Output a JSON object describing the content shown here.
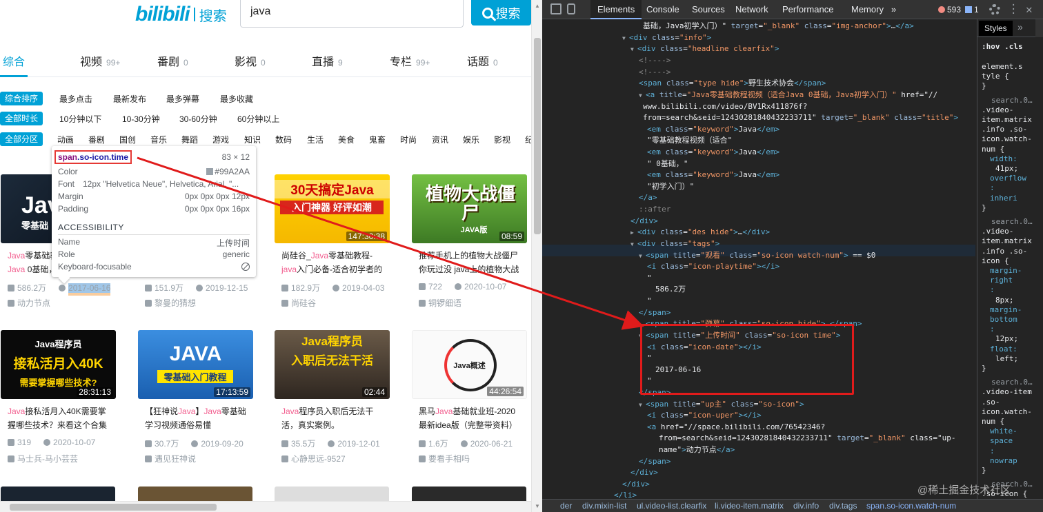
{
  "header": {
    "logo_text": "bilibili",
    "logo_sub": "搜索",
    "search_value": "java",
    "search_button": "搜索"
  },
  "tabs": [
    {
      "label": "综合",
      "count": ""
    },
    {
      "label": "视频",
      "count": "99+"
    },
    {
      "label": "番剧",
      "count": "0"
    },
    {
      "label": "影视",
      "count": "0"
    },
    {
      "label": "直播",
      "count": "9"
    },
    {
      "label": "专栏",
      "count": "99+"
    },
    {
      "label": "话题",
      "count": "0"
    }
  ],
  "filters": {
    "sort": {
      "label": "综合排序",
      "options": [
        "最多点击",
        "最新发布",
        "最多弹幕",
        "最多收藏"
      ]
    },
    "duration": {
      "label": "全部时长",
      "options": [
        "10分钟以下",
        "10-30分钟",
        "30-60分钟",
        "60分钟以上"
      ]
    },
    "zone": {
      "label": "全部分区",
      "options": [
        "动画",
        "番剧",
        "国创",
        "音乐",
        "舞蹈",
        "游戏",
        "知识",
        "数码",
        "生活",
        "美食",
        "鬼畜",
        "时尚",
        "资讯",
        "娱乐",
        "影视",
        "纪"
      ]
    }
  },
  "cards": [
    {
      "thumb_text": "Java",
      "thumb_sub": "零基础",
      "duration": "",
      "title_pre": "",
      "kw": "Java",
      "title_post": "零基础教程视频（适合",
      "line2_kw": "Java",
      "line2": " 0基础，",
      "views": "586.2万",
      "date": "2017-06-16",
      "uploader": "动力节点"
    },
    {
      "thumb_text": "",
      "thumb_sub": "",
      "duration": "",
      "title_pre": "",
      "kw": "",
      "title_post": "",
      "line2_kw": "",
      "line2": "",
      "views": "151.9万",
      "date": "2019-12-15",
      "uploader": "黎曼的猜想"
    },
    {
      "thumb_text": "30天搞定Java",
      "thumb_sub": "入门神器  好评如潮",
      "duration": "147:30:38",
      "title_pre": "尚硅谷_",
      "kw": "Java",
      "title_post": "零基础教程-",
      "line2_kw": "java",
      "line2": "入门必备-适合初学者的",
      "views": "182.9万",
      "date": "2019-04-03",
      "uploader": "尚硅谷"
    },
    {
      "thumb_text": "植物大战僵尸",
      "thumb_sub": "JAVA版",
      "duration": "08:59",
      "title_pre": "",
      "kw": "",
      "title_post": "推荐手机上的植物大战僵尸",
      "line2_kw": "",
      "line2": "你玩过没 java上的植物大战",
      "views": "722",
      "date": "2020-10-07",
      "uploader": "铜锣细语"
    },
    {
      "thumb_text": "Java程序员",
      "thumb_sub": "接私活月入40K",
      "thumb_sub2": "需要掌握哪些技术?",
      "duration": "28:31:13",
      "title_pre": "",
      "kw": "Java",
      "title_post": "接私活月入40K需要掌",
      "line2_kw": "",
      "line2": "握哪些技术？来看这个合集",
      "views": "319",
      "date": "2020-10-07",
      "uploader": "马士兵-马小芸芸"
    },
    {
      "thumb_text": "JAVA",
      "thumb_sub": "零基础入门教程",
      "duration": "17:13:59",
      "title_pre": "【狂神说",
      "kw": "Java",
      "title_post": "】",
      "title_post_kw": "Java",
      "title_post2": "零基础",
      "line2_kw": "",
      "line2": "学习视频通俗易懂",
      "views": "30.7万",
      "date": "2019-09-20",
      "uploader": "遇见狂神说"
    },
    {
      "thumb_text": "Java程序员",
      "thumb_sub": "入职后无法干活",
      "duration": "02:44",
      "title_pre": "",
      "kw": "Java",
      "title_post": "程序员入职后无法干",
      "line2_kw": "",
      "line2": "活，真实案例。",
      "views": "35.5万",
      "date": "2019-12-01",
      "uploader": "心静思远-9527"
    },
    {
      "thumb_text": "Java概述",
      "thumb_sub": "",
      "duration": "44:26:54",
      "title_pre": "黑马",
      "kw": "Java",
      "title_post": "基础就业班-2020",
      "line2_kw": "",
      "line2": "最新idea版（完整带资料）",
      "views": "1.6万",
      "date": "2020-06-21",
      "uploader": "要看手相吗"
    }
  ],
  "tooltip": {
    "selector_tag": "span",
    "selector_class": ".so-icon.time",
    "size": "83 × 12",
    "rows": [
      {
        "k": "Color",
        "v": "#99A2AA"
      },
      {
        "k": "Font",
        "v": "12px \"Helvetica Neue\", Helvetica, Arial, \"..."
      },
      {
        "k": "Margin",
        "v": "0px 0px 0px 12px"
      },
      {
        "k": "Padding",
        "v": "0px 0px 0px 16px"
      }
    ],
    "acc_header": "ACCESSIBILITY",
    "acc_rows": [
      {
        "k": "Name",
        "v": "上传时间"
      },
      {
        "k": "Role",
        "v": "generic"
      },
      {
        "k": "Keyboard-focusable",
        "v": ""
      }
    ]
  },
  "devtools": {
    "tabs": [
      "Elements",
      "Console",
      "Sources",
      "Network",
      "Performance",
      "Memory",
      "»"
    ],
    "errors": "593",
    "warnings": "1",
    "styles_tab": "Styles",
    "styles_more": "»",
    "hov": ":hov  .cls",
    "breadcrumb": [
      "der",
      "div.mixin-list",
      "ul.video-list.clearfix",
      "li.video-item.matrix",
      "div.info",
      "div.tags",
      "span.so-icon.watch-num"
    ]
  },
  "dom_lines": [
    "基础，Java初学入门）\" target=\"_blank\" class=\"img-anchor\">…</a>",
    "<div class=\"info\">",
    "<div class=\"headline clearfix\">",
    "<!---->",
    "<!---->",
    "<span class=\"type hide\">野生技术协会</span>",
    "<a title=\"Java零基础教程视频（适合Java 0基础，Java初学入门）\" href=\"//",
    "www.bilibili.com/video/BV1Rx411876f?",
    "from=search&seid=12430281840432233711\" target=\"_blank\" class=\"title\">",
    "<em class=\"keyword\">Java</em>",
    "\"零基础教程视频（适合\"",
    "<em class=\"keyword\">Java</em>",
    "\" 0基础，\"",
    "<em class=\"keyword\">Java</em>",
    "\"初学入门）\"",
    "</a>",
    "::after",
    "</div>",
    "<div class=\"des hide\">…</div>",
    "<div class=\"tags\">",
    "<span title=\"观看\" class=\"so-icon watch-num\"> == $0",
    "<i class=\"icon-playtime\"></i>",
    "\"",
    "586.2万",
    "\"",
    "</span>",
    "<span title=\"弹幕\" class=\"so-icon hide\">…</span>",
    "<span title=\"上传时间\" class=\"so-icon time\">",
    "<i class=\"icon-date\"></i>",
    "\"",
    "2017-06-16",
    "\"",
    "</span>",
    "<span title=\"up主\" class=\"so-icon\">",
    "<i class=\"icon-uper\"></i>",
    "<a href=\"//space.bilibili.com/76542346?",
    "from=search&seid=12430281840432233711\" target=\"_blank\" class=\"up-",
    "name\">动力节点</a>",
    "</span>",
    "</div>",
    "</div>",
    "</li>"
  ],
  "styles_lines": [
    "element.s",
    "tyle {",
    "}",
    "search.0…",
    ".video-",
    "item.matrix",
    ".info .so-",
    "icon.watch-",
    "num {",
    "width:",
    "41px;",
    "overflow",
    ": ",
    "inheri",
    "}",
    "search.0…",
    ".video-",
    "item.matrix",
    ".info .so-",
    "icon {",
    "margin-",
    "right",
    ":",
    "8px;",
    "margin-",
    "bottom",
    ":",
    "12px;",
    "float:",
    "left;",
    "}",
    "search.0…",
    ".video-item",
    ".so-",
    "icon.watch-",
    "num {",
    "white-",
    "space",
    ":",
    "nowrap",
    "}",
    "search.0…",
    ".so-icon {",
    "display"
  ],
  "watermark": "@稀土掘金技术社区",
  "colors": {
    "accent": "#00a1d6",
    "keyword": "#f25d8e",
    "meta": "#99a2aa",
    "annotation": "#e01b1b"
  }
}
